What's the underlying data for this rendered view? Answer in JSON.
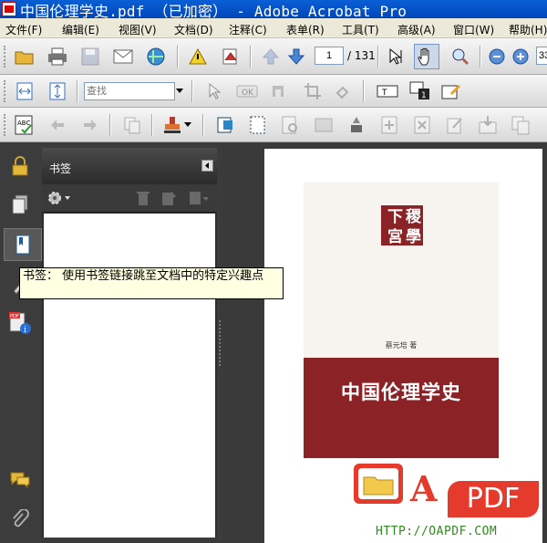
{
  "window": {
    "title": "中国伦理学史.pdf （已加密） - Adobe Acrobat Pro"
  },
  "menu": [
    "文件(F)",
    "编辑(E)",
    "视图(V)",
    "文档(D)",
    "注释(C)",
    "表单(R)",
    "工具(T)",
    "高级(A)",
    "窗口(W)",
    "帮助(H)"
  ],
  "navigation": {
    "current_page": "1",
    "total_pages": "/ 131",
    "zoom_value": "33"
  },
  "find": {
    "placeholder": "查找"
  },
  "bookmarks_panel": {
    "title": "书签"
  },
  "tooltip": {
    "text": "书签： 使用书签链接跳至文档中的特定兴趣点"
  },
  "cover": {
    "seal_line1": "稷下",
    "seal_line2": "學宮",
    "author": "蔡元培 著",
    "book_title": "中国伦理学史"
  },
  "watermark": {
    "letter": "A",
    "pdf": "PDF",
    "url": "HTTP://OAPDF.COM"
  },
  "colors": {
    "titlebar": "#0a5fd6",
    "cover_band": "#8b2226",
    "accent_green": "#2e8b1e",
    "watermark_red": "#e53b2d"
  }
}
